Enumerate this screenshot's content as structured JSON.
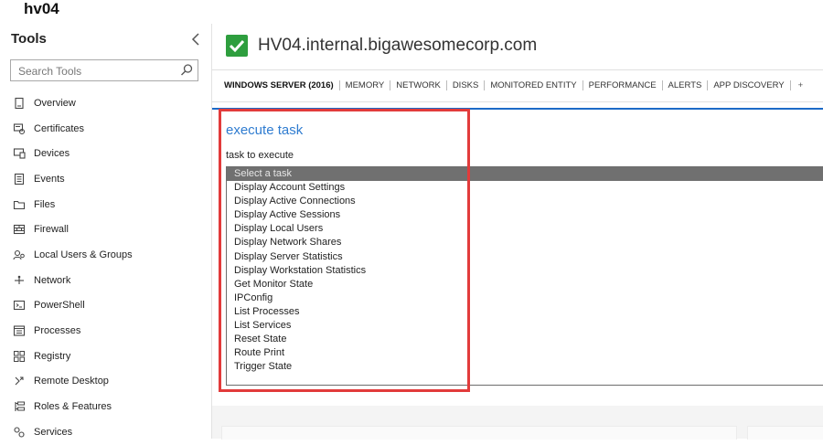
{
  "host_short": "hv04",
  "sidebar": {
    "title": "Tools",
    "search_placeholder": "Search Tools",
    "items": [
      {
        "label": "Overview",
        "icon": "overview-icon"
      },
      {
        "label": "Certificates",
        "icon": "certificate-icon"
      },
      {
        "label": "Devices",
        "icon": "devices-icon"
      },
      {
        "label": "Events",
        "icon": "events-icon"
      },
      {
        "label": "Files",
        "icon": "files-icon"
      },
      {
        "label": "Firewall",
        "icon": "firewall-icon"
      },
      {
        "label": "Local Users & Groups",
        "icon": "users-icon"
      },
      {
        "label": "Network",
        "icon": "network-icon"
      },
      {
        "label": "PowerShell",
        "icon": "powershell-icon"
      },
      {
        "label": "Processes",
        "icon": "processes-icon"
      },
      {
        "label": "Registry",
        "icon": "registry-icon"
      },
      {
        "label": "Remote Desktop",
        "icon": "remote-desktop-icon"
      },
      {
        "label": "Roles & Features",
        "icon": "roles-icon"
      },
      {
        "label": "Services",
        "icon": "services-icon"
      }
    ]
  },
  "header": {
    "hostname": "HV04.internal.bigawesomecorp.com",
    "status_icon": "check-icon",
    "status_color": "#2e9e3e"
  },
  "tabs": [
    {
      "label": "WINDOWS SERVER (2016)",
      "active": true
    },
    {
      "label": "MEMORY"
    },
    {
      "label": "NETWORK"
    },
    {
      "label": "DISKS"
    },
    {
      "label": "MONITORED ENTITY"
    },
    {
      "label": "PERFORMANCE"
    },
    {
      "label": "ALERTS"
    },
    {
      "label": "APP DISCOVERY"
    },
    {
      "label": "+"
    }
  ],
  "task": {
    "title": "execute task",
    "label": "task to execute",
    "options": [
      "Select a task",
      "Display Account Settings",
      "Display Active Connections",
      "Display Active Sessions",
      "Display Local Users",
      "Display Network Shares",
      "Display Server Statistics",
      "Display Workstation Statistics",
      "Get Monitor State",
      "IPConfig",
      "List Processes",
      "List Services",
      "Reset State",
      "Route Print",
      "Trigger State"
    ],
    "selected_index": 0
  },
  "colors": {
    "accent_blue": "#2f7cd0",
    "highlight_red": "#e23b3b",
    "selected_option": "#707070"
  }
}
